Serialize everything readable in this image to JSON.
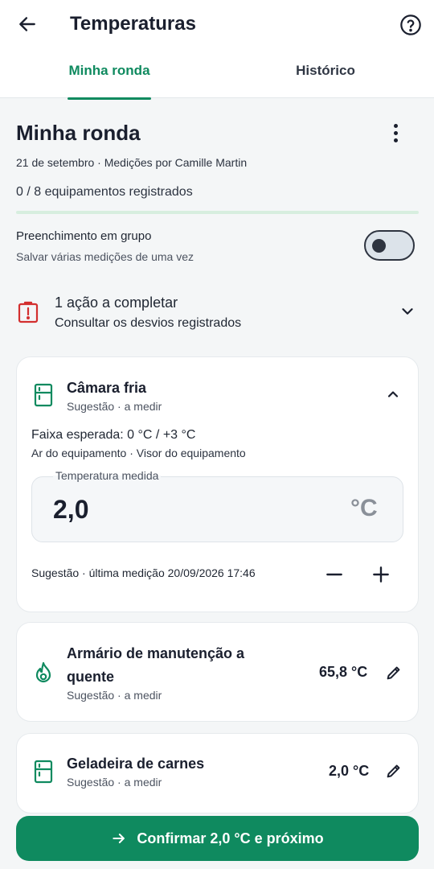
{
  "header": {
    "title": "Temperaturas",
    "back_icon": "arrow-left-icon",
    "help_icon": "question-circle-icon"
  },
  "tabs": [
    {
      "label": "Minha ronda",
      "active": true
    },
    {
      "label": "Histórico",
      "active": false
    }
  ],
  "round": {
    "title": "Minha ronda",
    "meta": "21 de setembro · Medições por Camille Martin",
    "count": "0 / 8 equipamentos registrados",
    "progress_fraction": 0
  },
  "group_fill": {
    "title": "Preenchimento em grupo",
    "subtitle": "Salvar várias medições de uma vez",
    "enabled": false
  },
  "alert": {
    "title": "1 ação a completar",
    "subtitle": "Consultar os desvios registrados"
  },
  "expanded_item": {
    "name": "Câmara fria",
    "status": "Sugestão · a medir",
    "range": "Faixa esperada: 0 °C / +3 °C",
    "sources": "Ar do equipamento · Visor do equipamento",
    "field_label": "Temperatura medida",
    "value": "2,0",
    "unit": "°C",
    "last_measure": "Sugestão · última medição 20/09/2026 17:46"
  },
  "items": [
    {
      "name_line1": "Armário de manutenção a",
      "name_line2": "quente",
      "status": "Sugestão · a medir",
      "value": "65,8 °C"
    },
    {
      "name": "Geladeira de carnes",
      "status": "Sugestão · a medir",
      "value": "2,0 °C"
    }
  ],
  "cta": {
    "label": "Confirmar 2,0 °C e próximo"
  },
  "colors": {
    "accent": "#0f8a5f",
    "alert": "#d32f2f",
    "progress_track": "#d7eedf"
  }
}
